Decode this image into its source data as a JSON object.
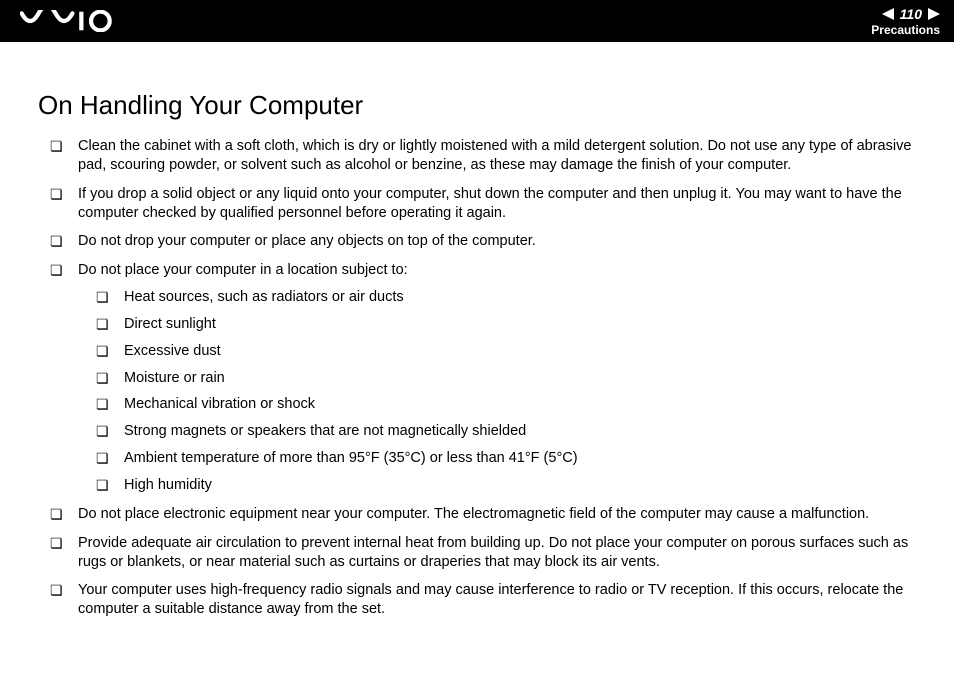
{
  "header": {
    "page_number": "110",
    "section": "Precautions"
  },
  "title": "On Handling Your Computer",
  "bullets": [
    "Clean the cabinet with a soft cloth, which is dry or lightly moistened with a mild detergent solution. Do not use any type of abrasive pad, scouring powder, or solvent such as alcohol or benzine, as these may damage the finish of your computer.",
    "If you drop a solid object or any liquid onto your computer, shut down the computer and then unplug it. You may want to have the computer checked by qualified personnel before operating it again.",
    "Do not drop your computer or place any objects on top of the computer.",
    "Do not place your computer in a location subject to:",
    "Do not place electronic equipment near your computer. The electromagnetic field of the computer may cause a malfunction.",
    "Provide adequate air circulation to prevent internal heat from building up. Do not place your computer on porous surfaces such as rugs or blankets, or near material such as curtains or draperies that may block its air vents.",
    "Your computer uses high-frequency radio signals and may cause interference to radio or TV reception. If this occurs, relocate the computer a suitable distance away from the set."
  ],
  "sub_bullets": [
    "Heat sources, such as radiators or air ducts",
    "Direct sunlight",
    "Excessive dust",
    "Moisture or rain",
    "Mechanical vibration or shock",
    "Strong magnets or speakers that are not magnetically shielded",
    "Ambient temperature of more than 95°F (35°C) or less than 41°F (5°C)",
    "High humidity"
  ]
}
